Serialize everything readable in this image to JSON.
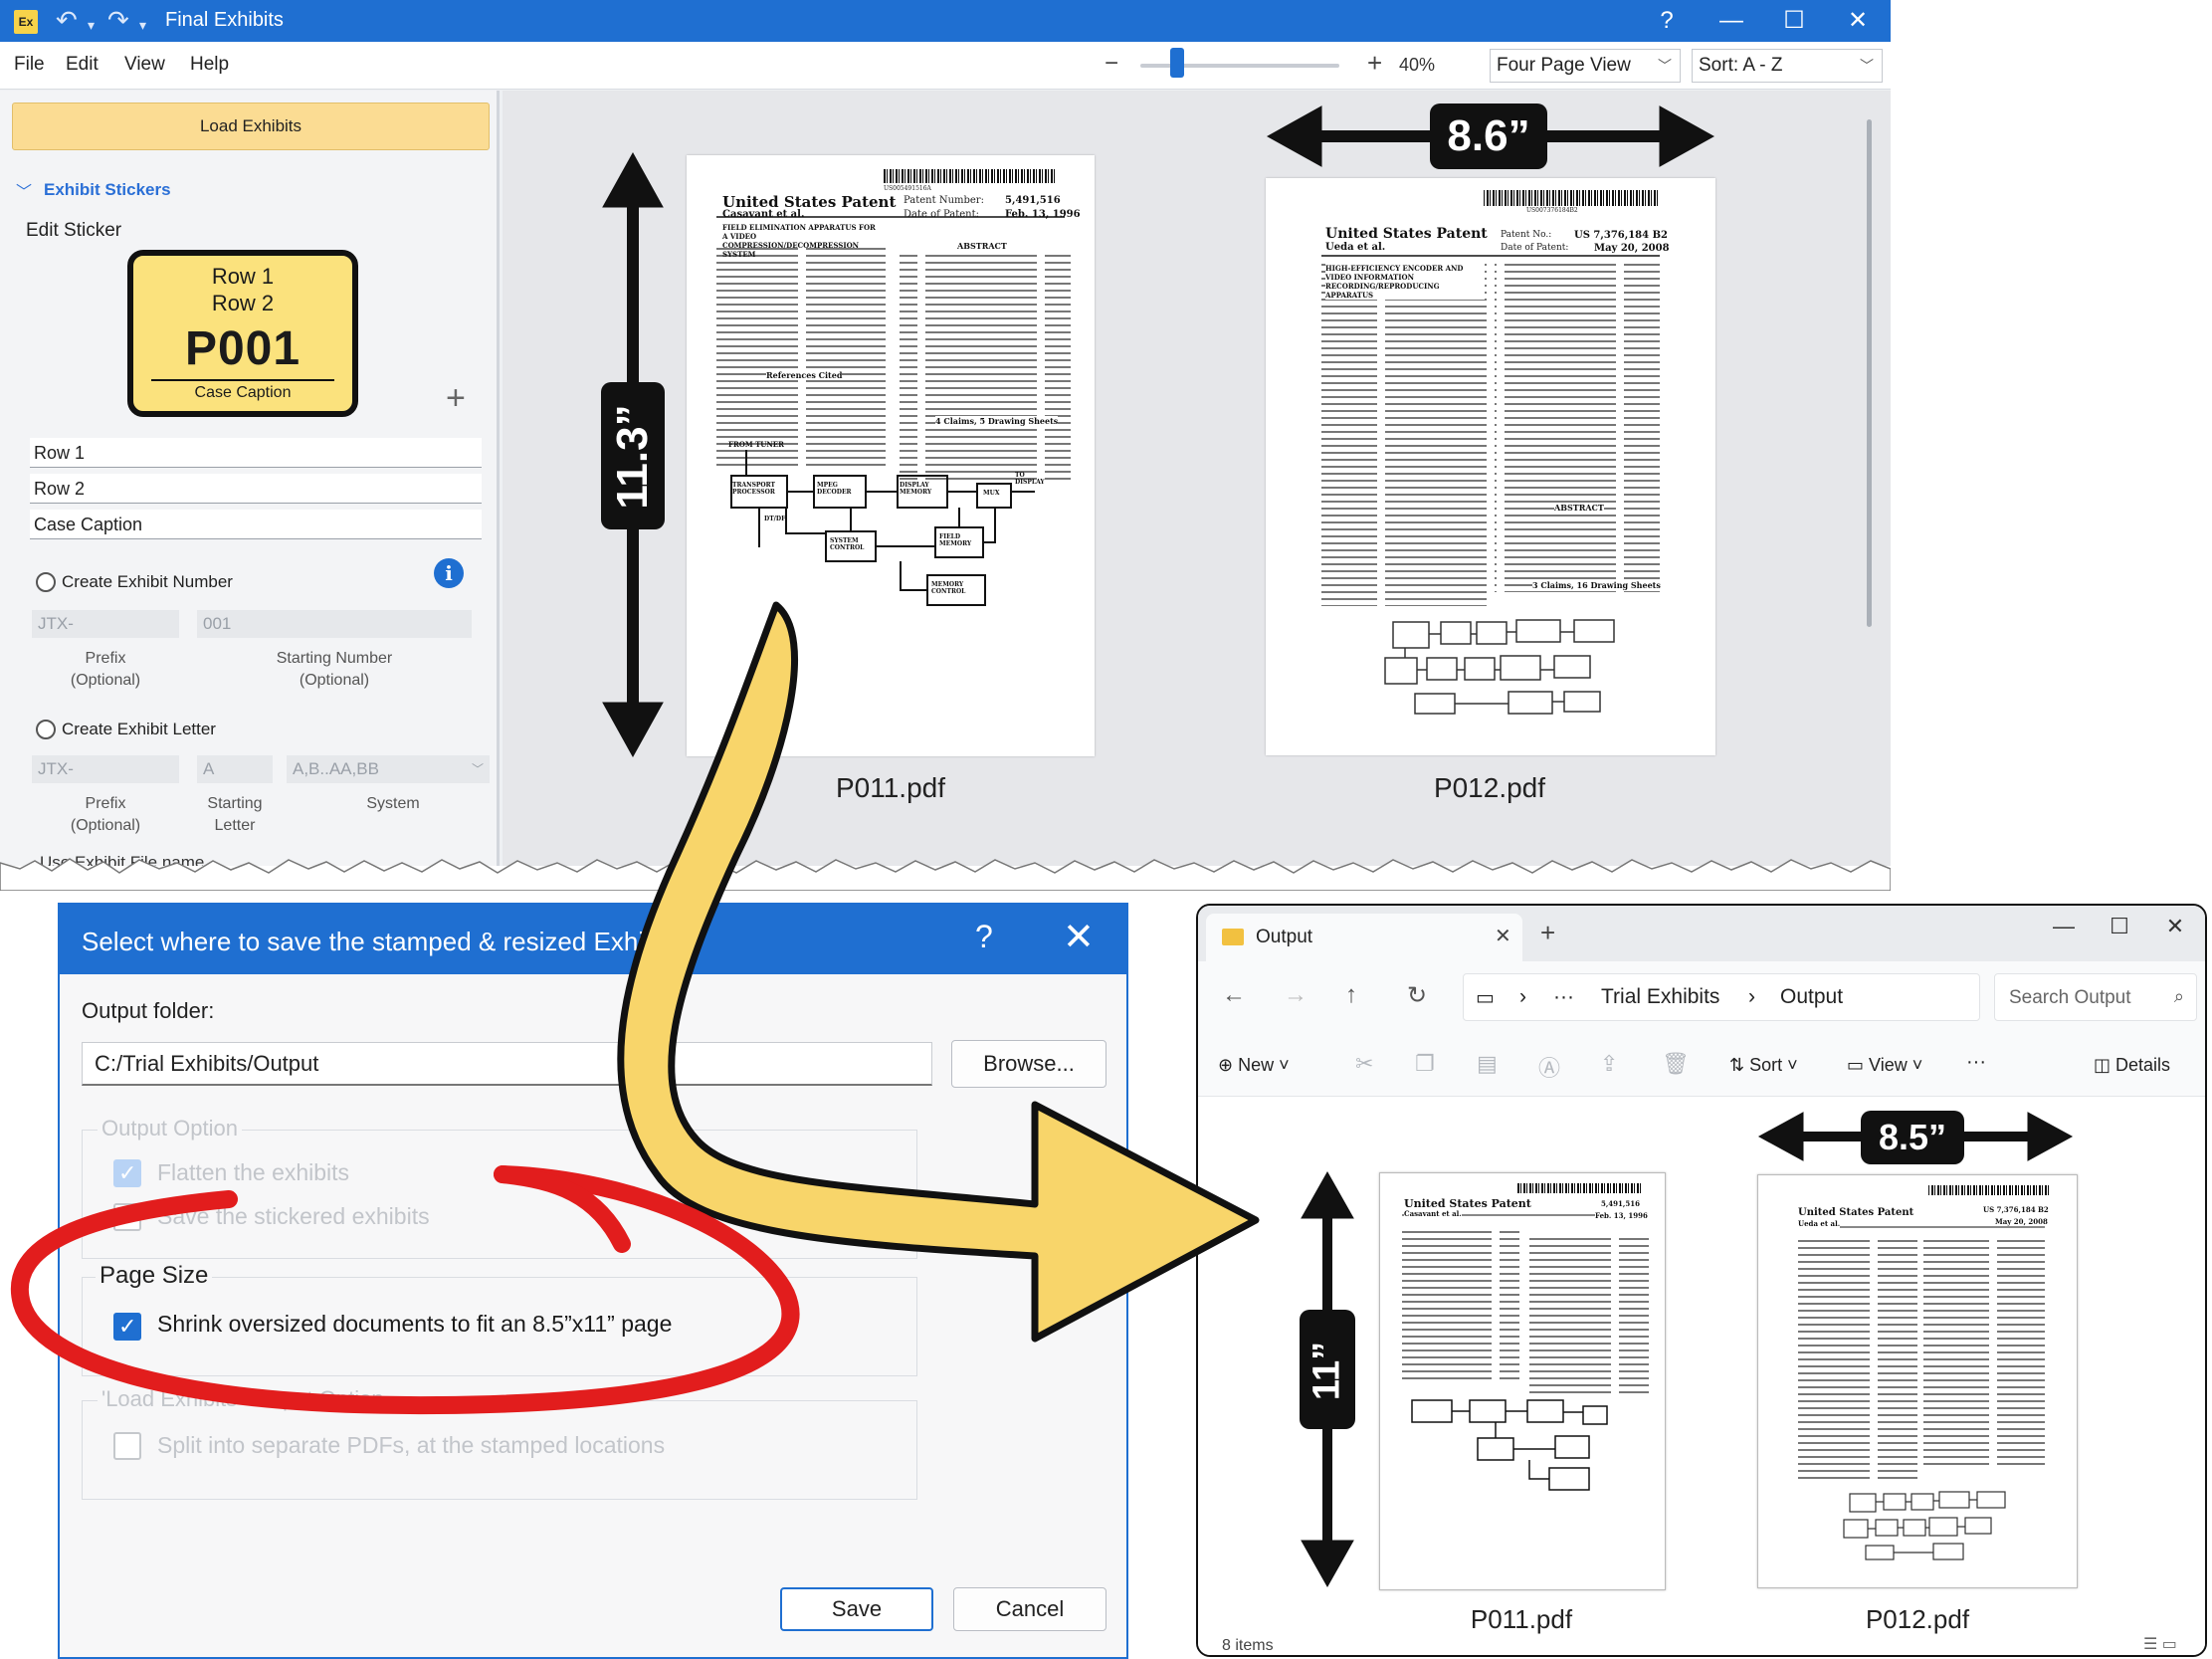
{
  "app": {
    "logo": "Ex",
    "title": "Final Exhibits",
    "help": "?",
    "menu": [
      "File",
      "Edit",
      "View",
      "Help"
    ],
    "zoom": {
      "minus": "−",
      "plus": "+",
      "value": "40%",
      "level_percent": 40
    },
    "view_mode": "Four Page View",
    "sort": "Sort: A - Z"
  },
  "left_pane": {
    "load_button": "Load Exhibits",
    "section_title": "Exhibit Stickers",
    "edit_sticker_label": "Edit Sticker",
    "sticker": {
      "row1": "Row 1",
      "row2": "Row 2",
      "number": "P001",
      "caption": "Case Caption"
    },
    "inputs": [
      "Row 1",
      "Row 2",
      "Case Caption"
    ],
    "create_number": {
      "label": "Create Exhibit Number",
      "prefix_value": "JTX-",
      "start_value": "001",
      "prefix_caption": [
        "Prefix",
        "(Optional)"
      ],
      "start_caption": [
        "Starting Number",
        "(Optional)"
      ]
    },
    "create_letter": {
      "label": "Create Exhibit Letter",
      "prefix_value": "JTX-",
      "start_value": "A",
      "system_value": "A,B..AA,BB",
      "prefix_caption": [
        "Prefix",
        "(Optional)"
      ],
      "start_caption": [
        "Starting",
        "Letter"
      ],
      "system_caption": "System"
    },
    "use_file_name": "Use Exhibit File name"
  },
  "preview": {
    "pages": [
      {
        "filename": "P011.pdf",
        "height_badge": "11.3”"
      },
      {
        "filename": "P012.pdf",
        "width_badge": "8.6”"
      }
    ]
  },
  "patents": {
    "p011": {
      "header": "United States Patent",
      "author": "Casavant et al.",
      "number_label": "Patent Number:",
      "number": "5,491,516",
      "date_label": "Date of Patent:",
      "date": "Feb. 13, 1996",
      "barcode_text": "US005491516A",
      "title": "FIELD ELIMINATION APPARATUS FOR A VIDEO COMPRESSION/DECOMPRESSION SYSTEM",
      "abstract_heading": "ABSTRACT",
      "refs_heading": "References Cited",
      "claims": "4 Claims, 5 Drawing Sheets",
      "diagram_labels": [
        "FROM TUNER",
        "TRANSPORT PROCESSOR",
        "MPEG DECODER",
        "DISPLAY MEMORY",
        "MUX",
        "TO DISPLAY",
        "FIELD MEMORY",
        "SYSTEM CONTROL",
        "MEMORY CONTROL",
        "DT/DF"
      ]
    },
    "p012": {
      "header": "United States Patent",
      "author": "Ueda et al.",
      "number_label": "Patent No.:",
      "number": "US 7,376,184 B2",
      "date_label": "Date of Patent:",
      "date": "May 20, 2008",
      "barcode_text": "US007376184B2",
      "title": "HIGH-EFFICIENCY ENCODER AND VIDEO INFORMATION RECORDING/REPRODUCING APPARATUS",
      "abstract_heading": "ABSTRACT",
      "claims": "3 Claims, 16 Drawing Sheets"
    }
  },
  "dialog": {
    "title": "Select where to save the stamped & resized Exhibits",
    "help": "?",
    "close": "✕",
    "output_folder_label": "Output folder:",
    "output_folder_value": "C:/Trial Exhibits/Output",
    "browse": "Browse...",
    "output_option_legend": "Output Option",
    "flatten": "Flatten the exhibits",
    "save_stickered": "Save the stickered exhibits",
    "page_size_legend": "Page Size",
    "shrink": "Shrink oversized documents to fit an 8.5”x11” page",
    "load_exhibits_legend": "'Load Exhibits' Output Option",
    "split": "Split into separate PDFs, at the stamped locations",
    "save": "Save",
    "cancel": "Cancel"
  },
  "explorer": {
    "tab_title": "Output",
    "address": [
      "Trial Exhibits",
      "Output"
    ],
    "search_placeholder": "Search Output",
    "toolbar": {
      "new": "New",
      "sort": "Sort",
      "view": "View",
      "more": "···",
      "details": "Details"
    },
    "files": [
      {
        "filename": "P011.pdf",
        "height_badge": "11”"
      },
      {
        "filename": "P012.pdf",
        "width_badge": "8.5”"
      }
    ],
    "status": "8 items"
  },
  "colors": {
    "accent": "#1f6fd1",
    "sticker_yellow": "#fbe27d",
    "load_button": "#fbdc93",
    "callout_arrow": "#f8d56a",
    "highlight_red": "#e21d1d"
  }
}
